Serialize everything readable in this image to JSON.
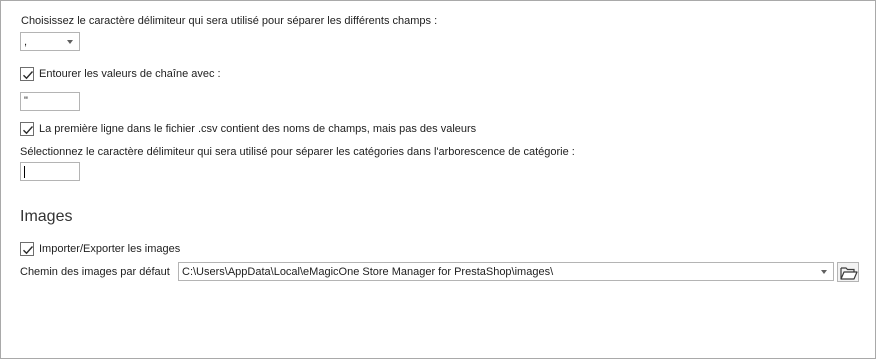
{
  "delimiter": {
    "label": "Choisissez le caractère délimiteur qui sera utilisé pour séparer les différents champs :",
    "value": ","
  },
  "quote": {
    "checkbox_label": "Entourer les valeurs de chaîne avec :",
    "checked": true,
    "value": "\""
  },
  "header_row": {
    "checkbox_label": "La première ligne dans le fichier .csv contient des noms de champs, mais pas des valeurs",
    "checked": true
  },
  "category_delimiter": {
    "label": "Sélectionnez le caractère délimiteur qui sera utilisé pour séparer les catégories dans l'arborescence de catégorie :",
    "value": ""
  },
  "images": {
    "section_title": "Images",
    "import_export_label": "Importer/Exporter les images",
    "import_export_checked": true,
    "path_label": "Chemin des images par défaut",
    "path_value": "C:\\Users\\AppData\\Local\\eMagicOne Store Manager for PrestaShop\\images\\",
    "browse_icon": "folder-open-icon"
  }
}
